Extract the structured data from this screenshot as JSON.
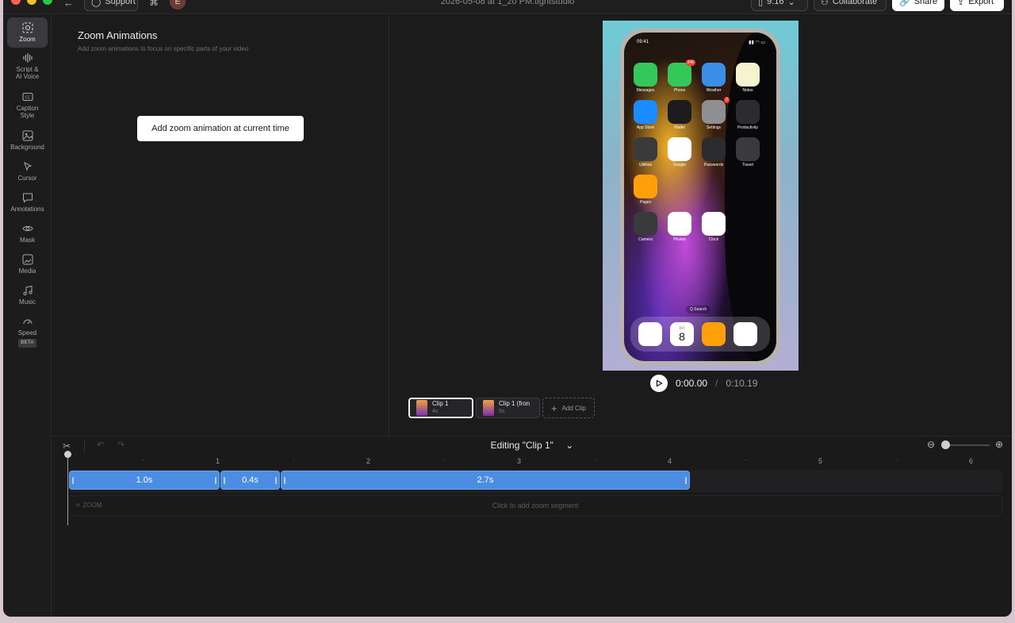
{
  "titlebar": {
    "support_label": "Support",
    "cmd_glyph": "⌘",
    "avatar_initial": "E",
    "document_title": "2026-05-08 at 1_20 PM.tightstudio",
    "ratio_label": "9:16",
    "collaborate_label": "Collaborate",
    "share_label": "Share",
    "export_label": "Export"
  },
  "rail": {
    "items": [
      {
        "label": "Zoom",
        "icon": "zoom-icon"
      },
      {
        "label": "Script &\nAI Voice",
        "icon": "waveform-icon"
      },
      {
        "label": "Caption\nStyle",
        "icon": "cc-icon"
      },
      {
        "label": "Background",
        "icon": "image-icon"
      },
      {
        "label": "Cursor",
        "icon": "cursor-icon"
      },
      {
        "label": "Annotations",
        "icon": "speech-bubble-icon"
      },
      {
        "label": "Mask",
        "icon": "eye-icon"
      },
      {
        "label": "Media",
        "icon": "media-icon"
      },
      {
        "label": "Music",
        "icon": "music-note-icon"
      },
      {
        "label": "Speed",
        "icon": "speedometer-icon",
        "badge": "BETA"
      }
    ]
  },
  "panel": {
    "title": "Zoom Animations",
    "subtitle": "Add zoom animations to focus on specific parts of your video",
    "add_button": "Add zoom animation at current time"
  },
  "phone": {
    "status_time": "09:41",
    "apps": [
      {
        "label": "Messages",
        "color": "#34c759"
      },
      {
        "label": "Phone",
        "color": "#34c759",
        "badge": "248"
      },
      {
        "label": "Weather",
        "color": "#3a8ee6"
      },
      {
        "label": "Notes",
        "color": "#f7f2d0"
      },
      {
        "label": "App Store",
        "color": "#1a8cff"
      },
      {
        "label": "Wallet",
        "color": "#1c1c1e"
      },
      {
        "label": "Settings",
        "color": "#8e8e93",
        "badge": "2"
      },
      {
        "label": "Productivity",
        "color": "#2c2c2e"
      },
      {
        "label": "Utilities",
        "color": "#3a3a3c"
      },
      {
        "label": "Google",
        "color": "#ffffff"
      },
      {
        "label": "Passwords",
        "color": "#2c2c2e"
      },
      {
        "label": "Travel",
        "color": "#3a3a3c"
      },
      {
        "label": "Pages",
        "color": "#ff9f0a"
      },
      {
        "label": "Camera",
        "color": "#3a3a3c"
      },
      {
        "label": "Photos",
        "color": "#ffffff"
      },
      {
        "label": "Clock",
        "color": "#ffffff"
      }
    ],
    "search_label": "Q Search",
    "dock": [
      "#ffffff",
      "#ffffff",
      "#ff9f0a",
      "#ffffff"
    ],
    "calendar_day": "Fri",
    "calendar_date": "8"
  },
  "player": {
    "current_time": "0:00.00",
    "separator": "/",
    "total_time": "0:10.19"
  },
  "clips": [
    {
      "name": "Clip 1",
      "duration": "4s"
    },
    {
      "name": "Clip 1 (fron",
      "duration": "6s"
    }
  ],
  "add_clip_label": "Add Clip",
  "timeline": {
    "editing_label": "Editing \"Clip 1\"",
    "ticks": [
      "1",
      "2",
      "3",
      "4",
      "5",
      "6"
    ],
    "segments": [
      "1.0s",
      "0.4s",
      "2.7s"
    ],
    "zoom_track_label": "ZOOM",
    "zoom_hint": "Click to add zoom segment",
    "zoom_level": 0.05
  },
  "colors": {
    "accent_segment": "#4a8de2",
    "background": "#1b1b1c"
  }
}
